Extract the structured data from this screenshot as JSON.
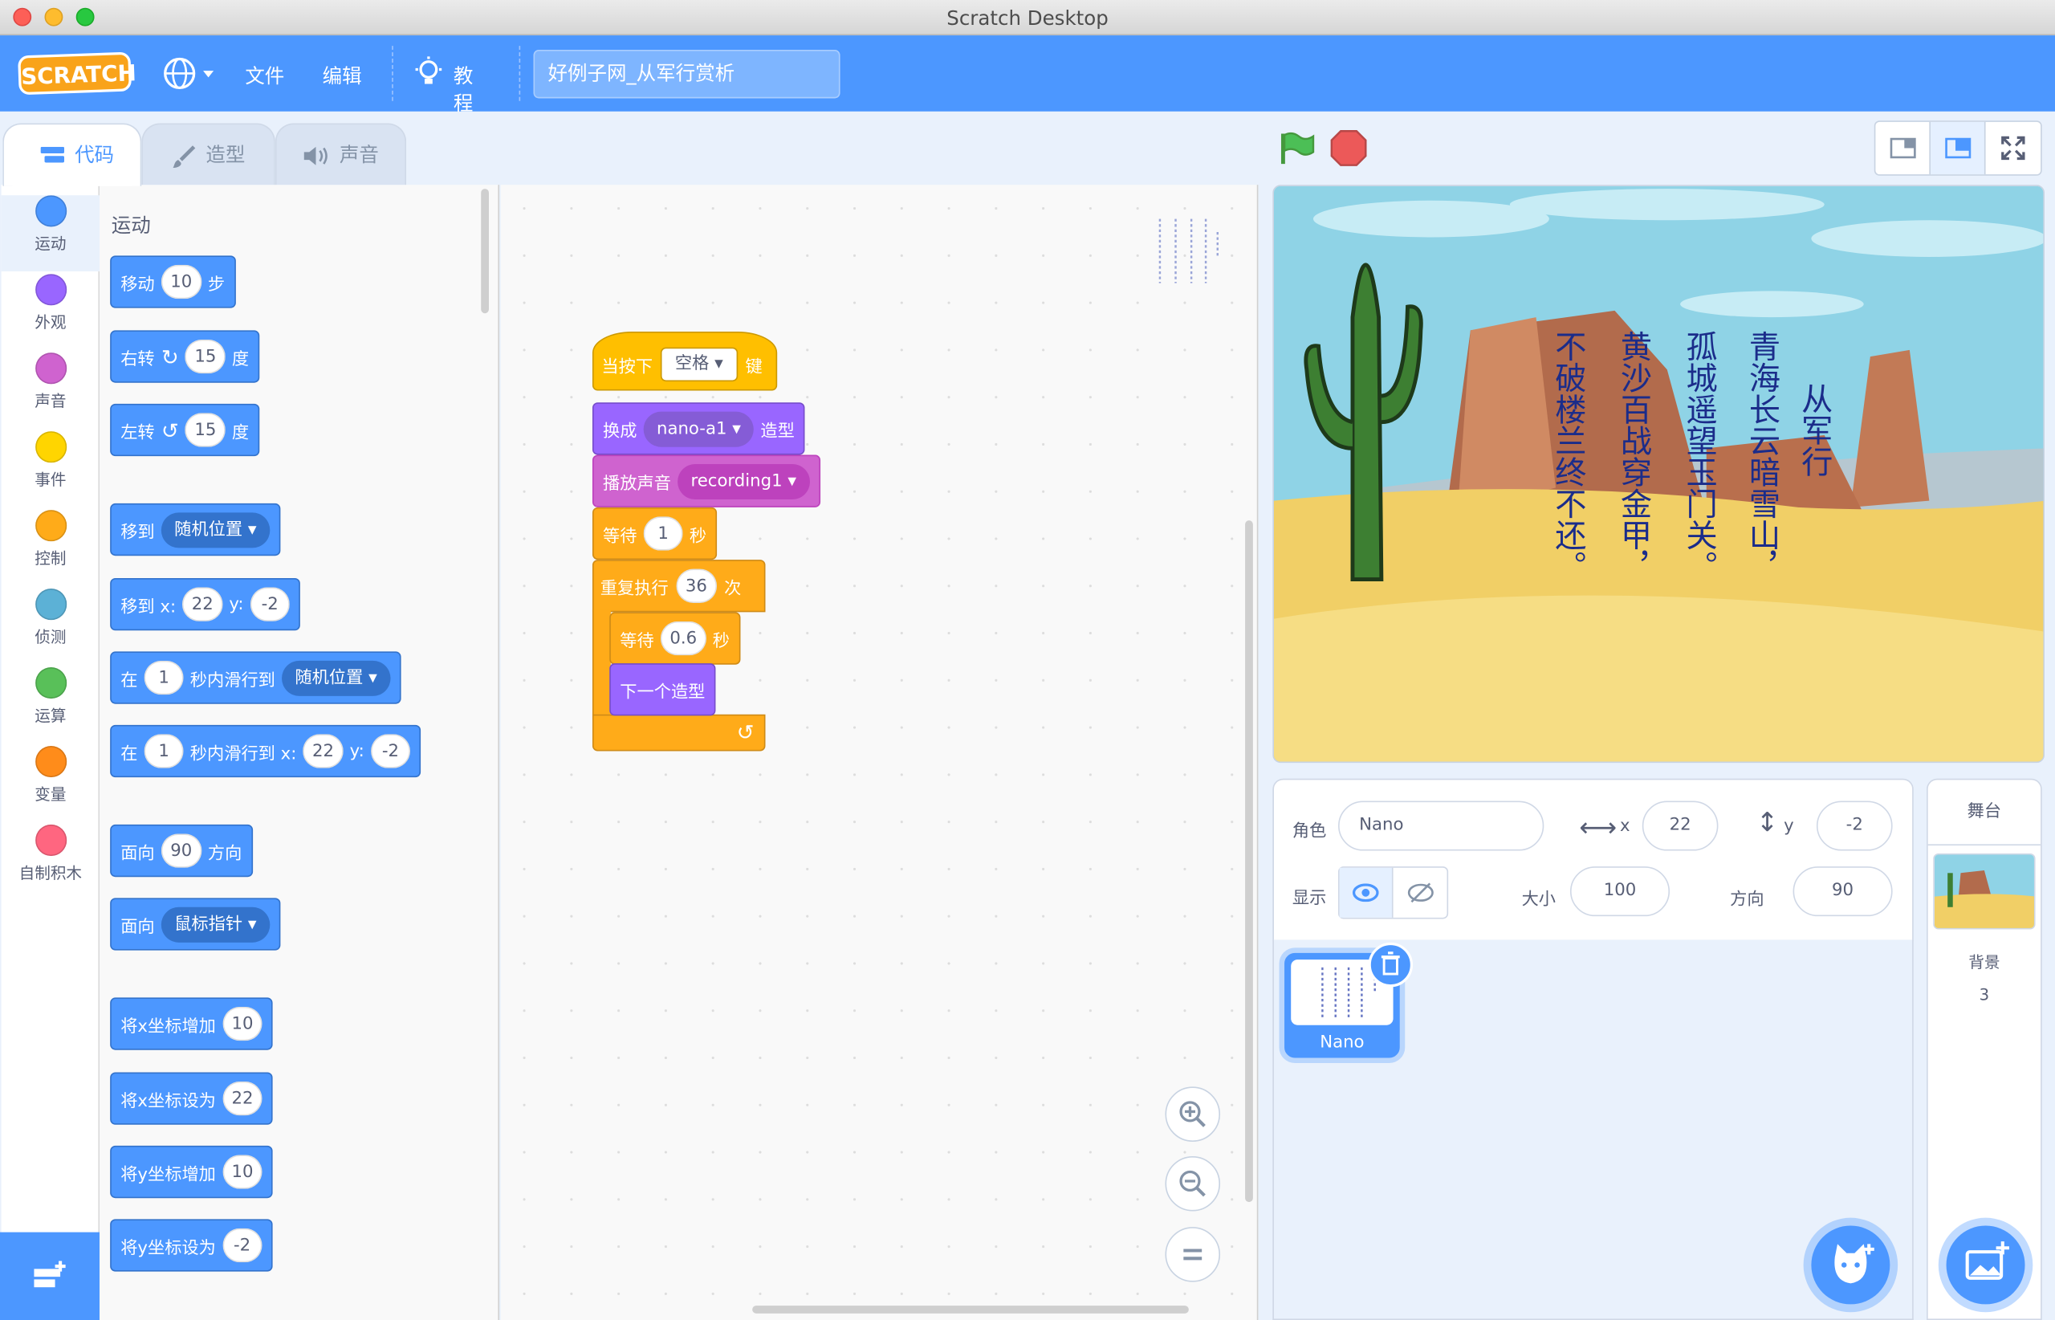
{
  "window": {
    "title": "Scratch Desktop"
  },
  "menu": {
    "logo": "SCRATCH",
    "file": "文件",
    "edit": "编辑",
    "tutorials": "教程",
    "project_title": "好例子网_从军行赏析"
  },
  "tabs": {
    "code": "代码",
    "costumes": "造型",
    "sounds": "声音"
  },
  "categories": [
    {
      "label": "运动",
      "color": "#4c97ff"
    },
    {
      "label": "外观",
      "color": "#9966ff"
    },
    {
      "label": "声音",
      "color": "#cf63cf"
    },
    {
      "label": "事件",
      "color": "#ffd500"
    },
    {
      "label": "控制",
      "color": "#ffab19"
    },
    {
      "label": "侦测",
      "color": "#5cb1d6"
    },
    {
      "label": "运算",
      "color": "#59c059"
    },
    {
      "label": "变量",
      "color": "#ff8c1a"
    },
    {
      "label": "自制积木",
      "color": "#ff6680"
    }
  ],
  "palette": {
    "heading": "运动",
    "move": {
      "a": "移动",
      "n": "10",
      "b": "步"
    },
    "turn_right": {
      "a": "右转",
      "n": "15",
      "b": "度"
    },
    "turn_left": {
      "a": "左转",
      "n": "15",
      "b": "度"
    },
    "goto": {
      "a": "移到",
      "dd": "随机位置"
    },
    "goto_xy": {
      "a": "移到 x:",
      "x": "22",
      "yl": "y:",
      "y": "-2"
    },
    "glide": {
      "a": "在",
      "n": "1",
      "b": "秒内滑行到",
      "dd": "随机位置"
    },
    "glide_xy": {
      "a": "在",
      "n": "1",
      "b": "秒内滑行到 x:",
      "x": "22",
      "yl": "y:",
      "y": "-2"
    },
    "point_dir": {
      "a": "面向",
      "n": "90",
      "b": "方向"
    },
    "point_towards": {
      "a": "面向",
      "dd": "鼠标指针"
    },
    "change_x": {
      "a": "将x坐标增加",
      "n": "10"
    },
    "set_x": {
      "a": "将x坐标设为",
      "n": "22"
    },
    "change_y": {
      "a": "将y坐标增加",
      "n": "10"
    },
    "set_y": {
      "a": "将y坐标设为",
      "n": "-2"
    }
  },
  "script": {
    "hat": {
      "a": "当按下",
      "dd": "空格",
      "b": "键"
    },
    "switch": {
      "a": "换成",
      "dd": "nano-a1",
      "b": "造型"
    },
    "sound": {
      "a": "播放声音",
      "dd": "recording1"
    },
    "wait1": {
      "a": "等待",
      "n": "1",
      "b": "秒"
    },
    "repeat": {
      "a": "重复执行",
      "n": "36",
      "b": "次"
    },
    "wait2": {
      "a": "等待",
      "n": "0.6",
      "b": "秒"
    },
    "next": {
      "a": "下一个造型"
    }
  },
  "poem": {
    "title": "从军行",
    "lines": [
      "青海长云暗雪山，",
      "孤城遥望玉门关。",
      "黄沙百战穿金甲，",
      "不破楼兰终不还。"
    ]
  },
  "sprite": {
    "label_sprite": "角色",
    "name": "Nano",
    "label_x": "x",
    "x": "22",
    "label_y": "y",
    "y": "-2",
    "label_show": "显示",
    "label_size": "大小",
    "size": "100",
    "label_dir": "方向",
    "dir": "90",
    "thumb_name": "Nano"
  },
  "stage_pane": {
    "title": "舞台",
    "label_backdrops": "背景",
    "backdrop_count": "3"
  }
}
